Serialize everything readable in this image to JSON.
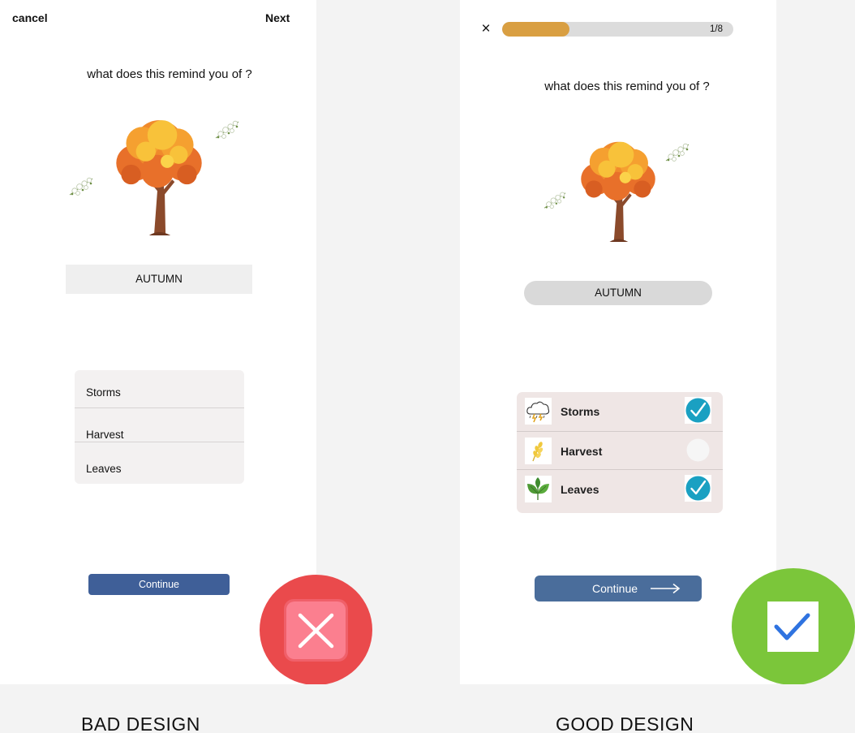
{
  "bad": {
    "cancel_label": "cancel",
    "next_label": "Next",
    "question": "what does this remind you of ?",
    "answer": "AUTUMN",
    "options": [
      {
        "label": "Storms"
      },
      {
        "label": "Harvest"
      },
      {
        "label": "Leaves"
      }
    ],
    "continue_label": "Continue",
    "badge_icon": "x-mark-icon",
    "caption": "BAD DESIGN"
  },
  "good": {
    "close_icon": "close-icon",
    "close_glyph": "×",
    "progress_text": "1/8",
    "progress_fraction": 0.29,
    "question": "what does this remind you of ?",
    "answer": "AUTUMN",
    "options": [
      {
        "label": "Storms",
        "icon": "storm-cloud-icon",
        "selected": true
      },
      {
        "label": "Harvest",
        "icon": "wheat-icon",
        "selected": false
      },
      {
        "label": "Leaves",
        "icon": "leaf-icon",
        "selected": true
      }
    ],
    "continue_label": "Continue",
    "continue_icon": "arrow-right-icon",
    "badge_icon": "check-mark-icon",
    "caption": "GOOD DESIGN"
  },
  "colors": {
    "accent_blue_bad": "#3f5f98",
    "accent_blue_good": "#4a6d9b",
    "progress_orange": "#d99f42",
    "check_teal": "#1aa0c2",
    "bad_badge": "#ea4a4c",
    "good_badge": "#7bc63a"
  }
}
